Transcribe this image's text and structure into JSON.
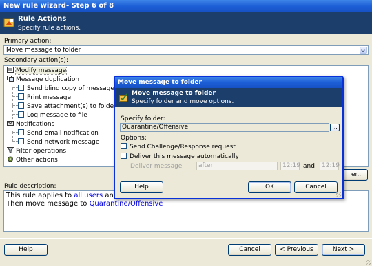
{
  "window": {
    "title": "New rule wizard- Step 6 of 8"
  },
  "header": {
    "title": "Rule Actions",
    "subtitle": "Specify rule actions."
  },
  "primary": {
    "label": "Primary action:",
    "value": "Move message to folder"
  },
  "secondary": {
    "label": "Secondary action(s):",
    "items": [
      {
        "label": "Modify message",
        "type": "group"
      },
      {
        "label": "Message duplication",
        "type": "group"
      },
      {
        "label": "Send blind copy of message",
        "type": "check"
      },
      {
        "label": "Print message",
        "type": "check"
      },
      {
        "label": "Save attachment(s) to folder",
        "type": "check"
      },
      {
        "label": "Log message to file",
        "type": "check"
      },
      {
        "label": "Notifications",
        "type": "group"
      },
      {
        "label": "Send email notification",
        "type": "check"
      },
      {
        "label": "Send network message",
        "type": "check"
      },
      {
        "label": "Filter operations",
        "type": "group"
      },
      {
        "label": "Other actions",
        "type": "group"
      }
    ],
    "hidden_button_fragment": "er..."
  },
  "description": {
    "label": "Rule description:",
    "line1_prefix": "This rule applies to ",
    "line1_link": "all users",
    "line1_suffix": " and ch",
    "line2_prefix": "Then move message to ",
    "line2_link": "Quarantine/Offensive"
  },
  "footer": {
    "help": "Help",
    "cancel": "Cancel",
    "previous": "< Previous",
    "next": "Next >"
  },
  "modal": {
    "title": "Move message to folder",
    "header_title": "Move message to folder",
    "header_subtitle": "Specify folder and move options.",
    "folder_label": "Specify folder:",
    "folder_value": "Quarantine/Offensive",
    "browse_label": "...",
    "options_label": "Options:",
    "opt_challenge": "Send Challenge/Response request",
    "opt_deliver": "Deliver this message automatically",
    "deliver_label": "Deliver message",
    "deliver_value": "after",
    "time1": "12:19",
    "and_label": "and",
    "time2": "12:19",
    "help": "Help",
    "ok": "OK",
    "cancel": "Cancel"
  }
}
